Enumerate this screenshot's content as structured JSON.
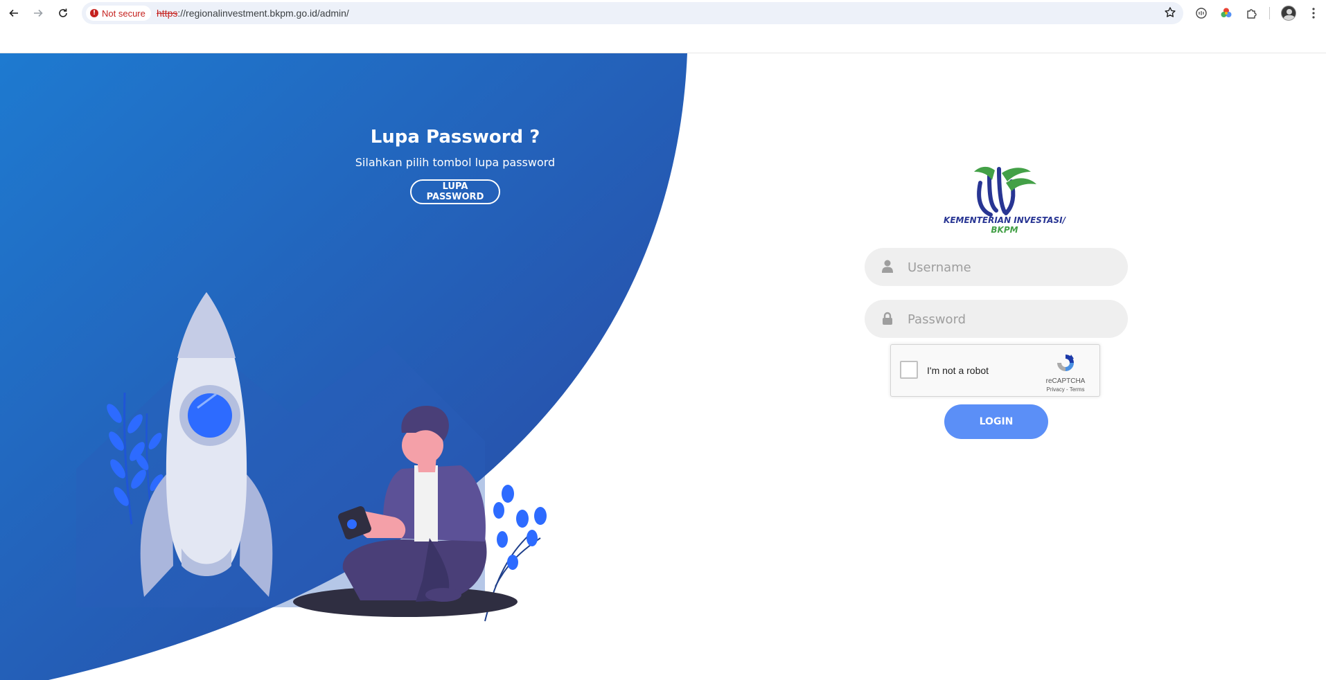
{
  "browser": {
    "security_chip": "Not secure",
    "url_protocol": "https",
    "url_rest": "://regionalinvestment.bkpm.go.id/admin/"
  },
  "forgot": {
    "title": "Lupa Password ?",
    "subtitle": "Silahkan pilih tombol lupa password",
    "button_label": "LUPA PASSWORD"
  },
  "logo": {
    "line1": "KEMENTERIAN INVESTASI/",
    "line2": "BKPM"
  },
  "login": {
    "username_placeholder": "Username",
    "username_value": "",
    "password_placeholder": "Password",
    "password_value": "",
    "captcha_label": "I'm not a robot",
    "captcha_brand": "reCAPTCHA",
    "captcha_links": "Privacy - Terms",
    "button_label": "LOGIN"
  },
  "colors": {
    "hero_gradient_start": "#1e7ad0",
    "hero_gradient_end": "#2a4fa6",
    "login_button": "#5b8ff7",
    "field_bg": "#efefef"
  }
}
